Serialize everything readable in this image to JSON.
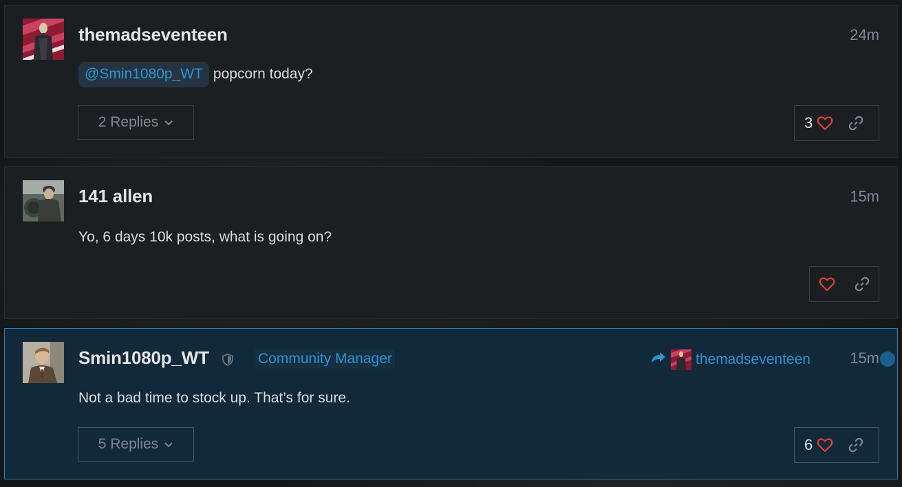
{
  "posts": [
    {
      "username": "themadseventeen",
      "time": "24m",
      "mention": "@Smin1080p_WT",
      "text": "popcorn today?",
      "replies_label": "2 Replies",
      "likes": "3"
    },
    {
      "username": "141 allen",
      "time": "15m",
      "text": "Yo, 6 days 10k posts, what is going on?"
    },
    {
      "username": "Smin1080p_WT",
      "time": "15m",
      "role": "Community Manager",
      "reply_to": "themadseventeen",
      "text": "Not a bad time to stock up. That’s for sure.",
      "replies_label": "5 Replies",
      "likes": "6"
    }
  ],
  "colors": {
    "accent": "#2d93cf",
    "heart": "#e0403a",
    "highlight_bg": "#12293a",
    "post_bg": "#1c1f22"
  }
}
